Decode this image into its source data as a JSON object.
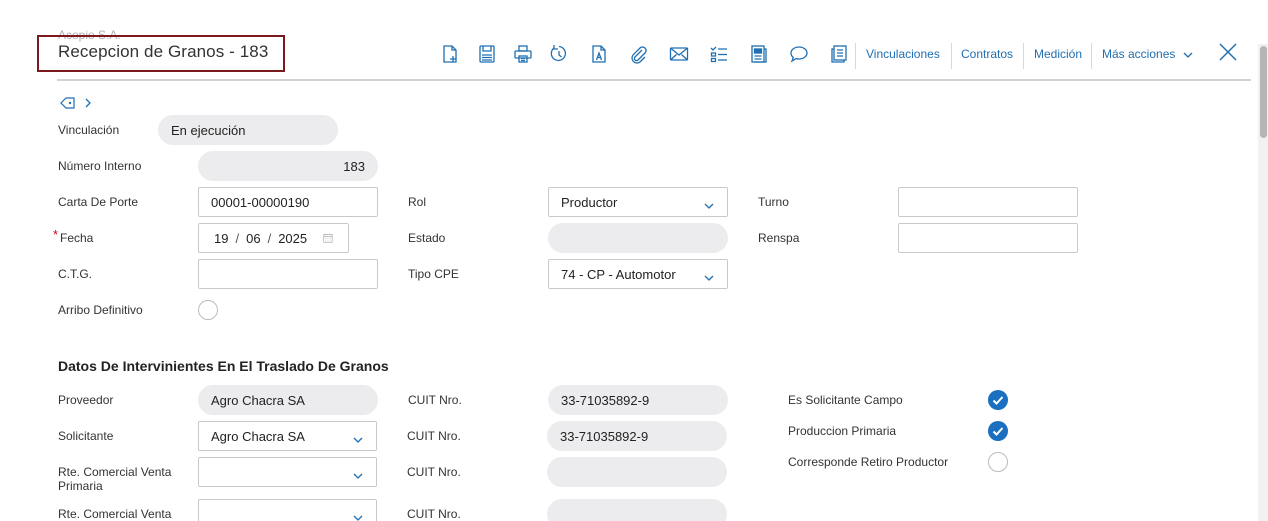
{
  "header": {
    "company": "Acopio S.A.",
    "title": "Recepcion de Granos - 183"
  },
  "toolbar": {
    "icons": [
      "new-document-icon",
      "save-icon",
      "print-icon",
      "history-icon",
      "document-a-icon",
      "attach-icon",
      "mail-icon",
      "checklist-icon",
      "report-icon",
      "comment-icon",
      "copy-document-icon"
    ],
    "links": {
      "vinculaciones": "Vinculaciones",
      "contratos": "Contratos",
      "medicion": "Medición",
      "mas_acciones": "Más acciones"
    }
  },
  "colors": {
    "accent": "#1a6fc0",
    "link": "#1f6fb2",
    "title_border": "#7a1a1f"
  },
  "form": {
    "vinculacion": {
      "label": "Vinculación",
      "value": "En ejecución"
    },
    "numero_interno": {
      "label": "Número Interno",
      "value": "183"
    },
    "carta_de_porte": {
      "label": "Carta De Porte",
      "value": "00001-00000190"
    },
    "rol": {
      "label": "Rol",
      "value": "Productor"
    },
    "turno": {
      "label": "Turno",
      "value": ""
    },
    "fecha": {
      "required": "*",
      "label": "Fecha",
      "day": "19",
      "month": "06",
      "year": "2025"
    },
    "estado": {
      "label": "Estado",
      "value": ""
    },
    "renspa": {
      "label": "Renspa",
      "value": ""
    },
    "ctg": {
      "label": "C.T.G.",
      "value": ""
    },
    "tipo_cpe": {
      "label": "Tipo CPE",
      "value": "74 - CP - Automotor"
    },
    "arribo_definitivo": {
      "label": "Arribo Definitivo",
      "checked": false
    }
  },
  "section": {
    "title": "Datos De Intervinientes En El Traslado De Granos",
    "proveedor": {
      "label": "Proveedor",
      "value": "Agro Chacra SA",
      "cuit_label": "CUIT Nro.",
      "cuit": "33-71035892-9"
    },
    "solicitante": {
      "label": "Solicitante",
      "value": "Agro Chacra SA",
      "cuit_label": "CUIT Nro.",
      "cuit": "33-71035892-9"
    },
    "rte_primaria": {
      "label": "Rte. Comercial Venta Primaria",
      "value": "",
      "cuit_label": "CUIT Nro.",
      "cuit": ""
    },
    "rte_venta": {
      "label": "Rte. Comercial Venta",
      "value": "",
      "cuit_label": "CUIT Nro.",
      "cuit": ""
    },
    "es_solicitante_campo": {
      "label": "Es Solicitante Campo",
      "checked": true
    },
    "produccion_primaria": {
      "label": "Produccion Primaria",
      "checked": true
    },
    "corresponde_retiro": {
      "label": "Corresponde Retiro Productor",
      "checked": false
    }
  }
}
